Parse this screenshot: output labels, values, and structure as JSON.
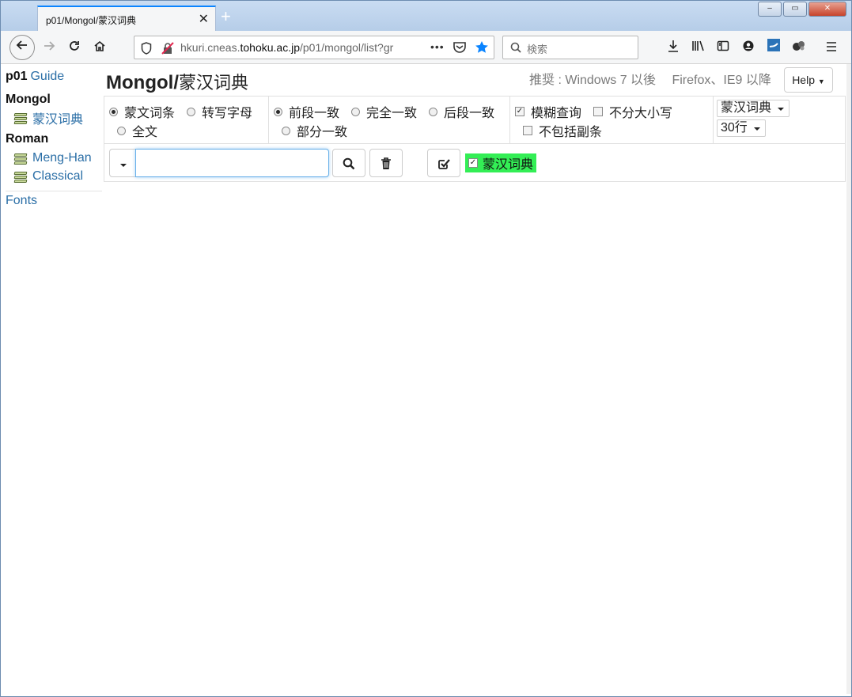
{
  "browser": {
    "tab_title": "p01/Mongol/蒙汉词典",
    "tab_close": "✕",
    "new_tab": "+",
    "window_buttons": {
      "minimize": "–",
      "maximize": "▭",
      "close": "✕"
    },
    "url_host_prefix": "hkuri.cneas.",
    "url_host_main": "tohoku.ac.jp",
    "url_path": "/p01/mongol/list?gr",
    "url_more": "•••",
    "search_placeholder": "検索",
    "icons": [
      "back-icon",
      "forward-icon",
      "reload-icon",
      "home-icon",
      "shield-icon",
      "insecure-lock-icon",
      "pocket-icon",
      "bookmark-star-icon",
      "search-icon",
      "download-icon",
      "library-icon",
      "sidebar-icon",
      "account-icon",
      "extension-icon",
      "extension2-icon",
      "menu-icon"
    ]
  },
  "sidebar": {
    "p01_label": "p01",
    "guide_label": "Guide",
    "mongol_heading": "Mongol",
    "mongol_items": [
      {
        "label": "蒙汉词典"
      }
    ],
    "roman_heading": "Roman",
    "roman_items": [
      {
        "label": "Meng-Han"
      },
      {
        "label": "Classical"
      }
    ],
    "fonts_label": "Fonts"
  },
  "header": {
    "title": "Mongol",
    "title_sep": "/",
    "title_cn": "蒙汉词典",
    "note": "推奨 : Windows 7 以後　 Firefox、IE9 以降",
    "help_label": "Help"
  },
  "options": {
    "field": [
      {
        "label": "蒙文词条",
        "checked": true
      },
      {
        "label": "转写字母",
        "checked": false
      },
      {
        "label": "全文",
        "checked": false
      }
    ],
    "match": [
      {
        "label": "前段一致",
        "checked": true
      },
      {
        "label": "完全一致",
        "checked": false
      },
      {
        "label": "后段一致",
        "checked": false
      },
      {
        "label": "部分一致",
        "checked": false
      }
    ],
    "flags": [
      {
        "label": "模糊查询",
        "checked": true
      },
      {
        "label": "不分大小写",
        "checked": false
      },
      {
        "label": "不包括副条",
        "checked": false
      }
    ],
    "dict_select": "蒙汉词典",
    "rows_select": "30行"
  },
  "toolbar": {
    "query_value": "",
    "dict_tag_label": "蒙汉词典",
    "dict_tag_checked": true,
    "check_mark": "✓"
  },
  "colors": {
    "link": "#2a6ea6",
    "highlight": "#33ee55",
    "focus": "#66afe9"
  }
}
